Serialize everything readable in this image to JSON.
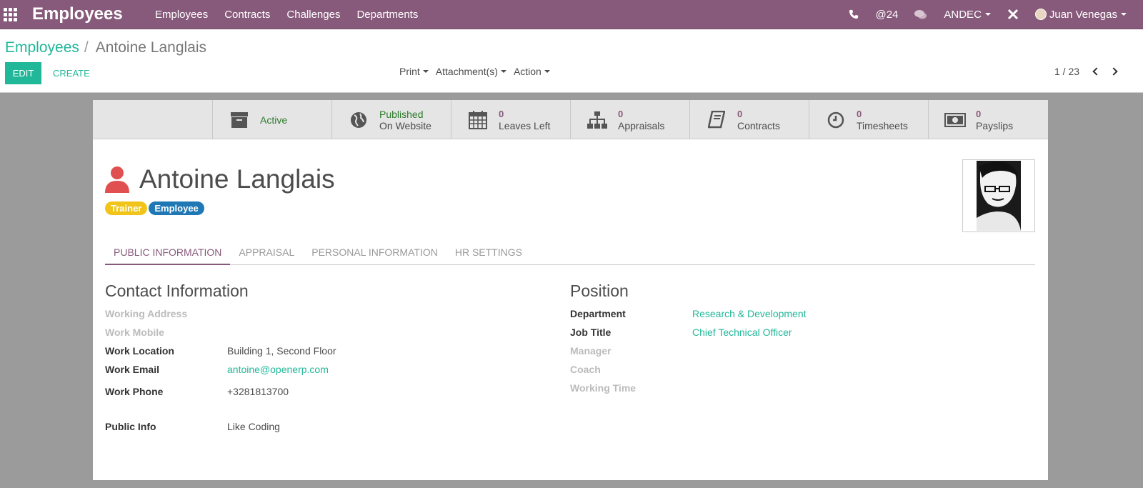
{
  "navbar": {
    "brand": "Employees",
    "menu": [
      "Employees",
      "Contracts",
      "Challenges",
      "Departments"
    ],
    "mentions": "@24",
    "company": "ANDEC",
    "user": "Juan Venegas"
  },
  "control": {
    "breadcrumb_parent": "Employees",
    "breadcrumb_separator": "/",
    "breadcrumb_current": "Antoine Langlais",
    "edit_label": "EDIT",
    "create_label": "CREATE",
    "print_label": "Print",
    "attachments_label": "Attachment(s)",
    "action_label": "Action",
    "pager": "1 / 23"
  },
  "stats": [
    {
      "label": "Active",
      "icon": "archive-icon"
    },
    {
      "line1": "Published",
      "line2": "On Website",
      "icon": "globe-icon"
    },
    {
      "num": "0",
      "label": "Leaves Left",
      "icon": "calendar-icon"
    },
    {
      "num": "0",
      "label": "Appraisals",
      "icon": "sitemap-icon"
    },
    {
      "num": "0",
      "label": "Contracts",
      "icon": "book-icon"
    },
    {
      "num": "0",
      "label": "Timesheets",
      "icon": "clock-icon"
    },
    {
      "num": "0",
      "label": "Payslips",
      "icon": "money-icon"
    }
  ],
  "employee": {
    "name": "Antoine Langlais",
    "tags": [
      {
        "label": "Trainer",
        "color": "#f0c419"
      },
      {
        "label": "Employee",
        "color": "#1f78b4"
      }
    ]
  },
  "tabs": [
    "PUBLIC INFORMATION",
    "APPRAISAL",
    "PERSONAL INFORMATION",
    "HR SETTINGS"
  ],
  "contact": {
    "title": "Contact Information",
    "working_address": "Working Address",
    "work_mobile": "Work Mobile",
    "work_location_label": "Work Location",
    "work_location": "Building 1, Second Floor",
    "work_email_label": "Work Email",
    "work_email": "antoine@openerp.com",
    "work_phone_label": "Work Phone",
    "work_phone": "+3281813700",
    "public_info_label": "Public Info",
    "public_info": "Like Coding"
  },
  "position": {
    "title": "Position",
    "department_label": "Department",
    "department": "Research & Development",
    "job_title_label": "Job Title",
    "job_title": "Chief Technical Officer",
    "manager_label": "Manager",
    "coach_label": "Coach",
    "working_time_label": "Working Time"
  }
}
